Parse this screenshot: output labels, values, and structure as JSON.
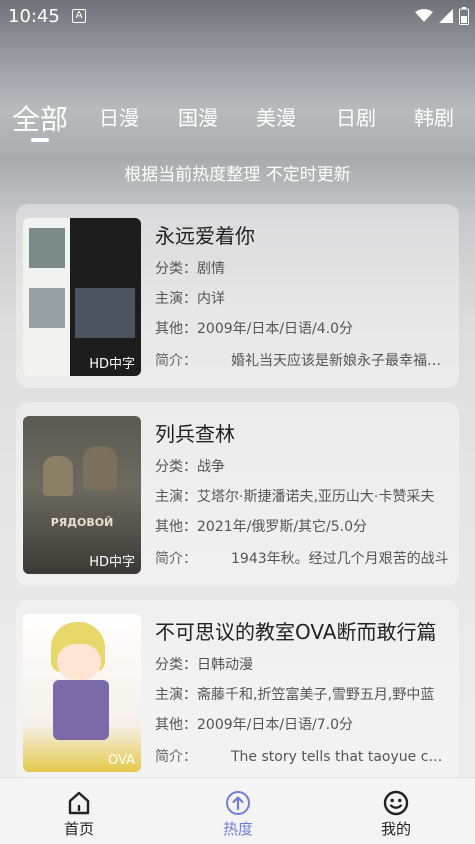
{
  "status": {
    "time": "10:45"
  },
  "tabs": [
    {
      "label": "全部"
    },
    {
      "label": "日漫"
    },
    {
      "label": "国漫"
    },
    {
      "label": "美漫"
    },
    {
      "label": "日剧"
    },
    {
      "label": "韩剧"
    }
  ],
  "subtitle": "根据当前热度整理 不定时更新",
  "items": [
    {
      "title": "永远爱着你",
      "category": "分类：剧情",
      "cast": "主演：内详",
      "other": "其他：2009年/日本/日语/4.0分",
      "intro_label": "简介：",
      "intro": "婚礼当天应该是新娘永子最幸福的一天",
      "badge": "HD中字"
    },
    {
      "title": "列兵查林",
      "category": "分类：战争",
      "cast": "主演：艾塔尔·斯捷潘诺夫,亚历山大·卡赞采夫",
      "other": "其他：2021年/俄罗斯/其它/5.0分",
      "intro_label": "简介：",
      "intro": "1943年秋。经过几个月艰苦的战斗",
      "badge": "HD中字"
    },
    {
      "title": "不可思议的教室OVA断而敢行篇",
      "category": "分类：日韩动漫",
      "cast": "主演：斋藤千和,折笠富美子,雪野五月,野中蓝",
      "other": "其他：2009年/日本/日语/7.0分",
      "intro_label": "简介：",
      "intro": "The story tells that taoyue comes to a new school",
      "badge": "OVA"
    }
  ],
  "nav": [
    {
      "label": "首页"
    },
    {
      "label": "热度"
    },
    {
      "label": "我的"
    }
  ],
  "colors": {
    "accent": "#6f7fd8"
  }
}
